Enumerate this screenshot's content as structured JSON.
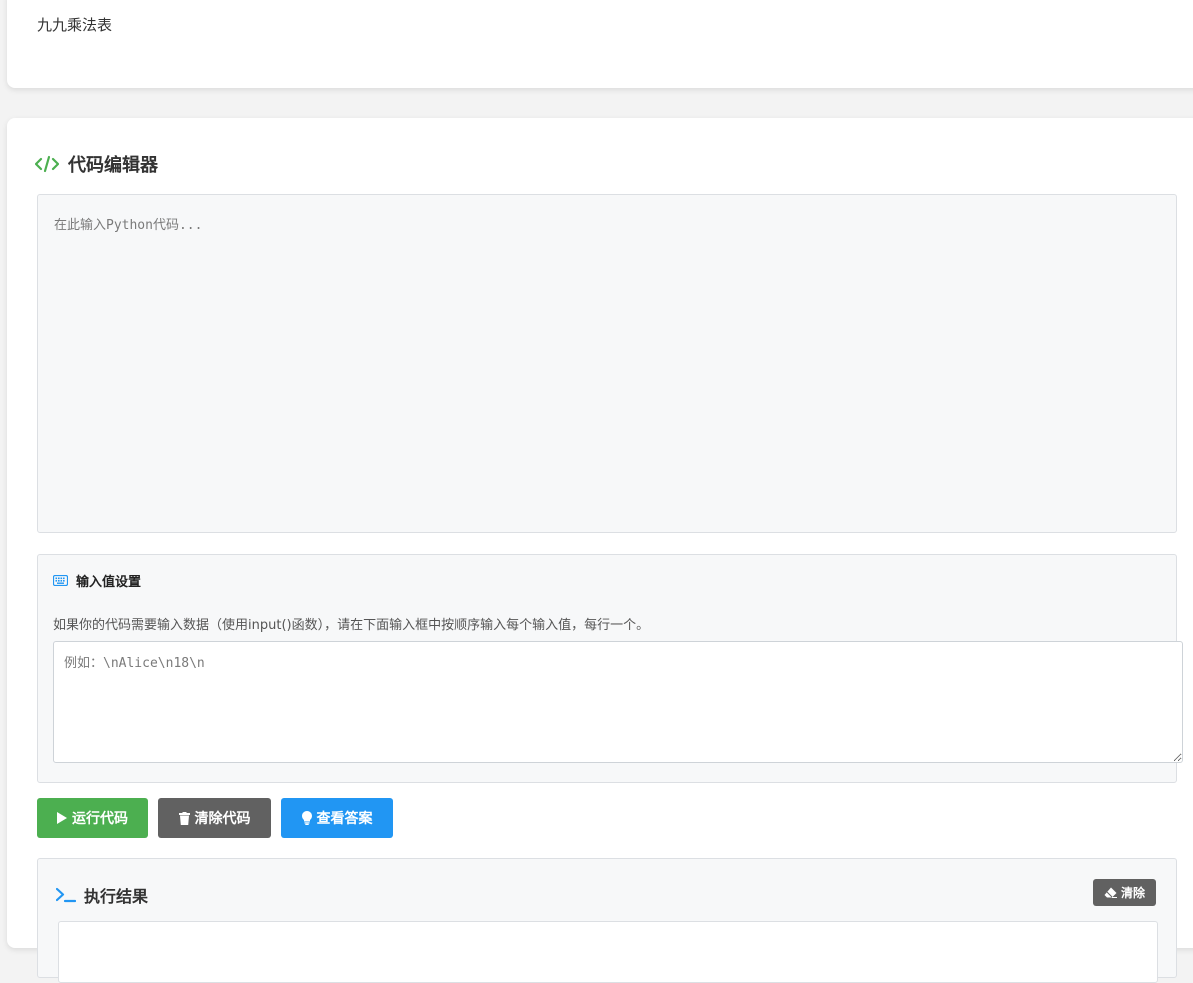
{
  "problem": {
    "title": "九九乘法表"
  },
  "editor": {
    "title": "代码编辑器",
    "code_value": "",
    "code_placeholder": "在此输入Python代码..."
  },
  "input_settings": {
    "title": "输入值设置",
    "description": "如果你的代码需要输入数据（使用input()函数），请在下面输入框中按顺序输入每个输入值，每行一个。",
    "value": "",
    "placeholder": "例如：\\nAlice\\n18\\n"
  },
  "buttons": {
    "run_label": "运行代码",
    "clear_code_label": "清除代码",
    "view_answer_label": "查看答案"
  },
  "result": {
    "title": "执行结果",
    "clear_label": "清除",
    "output": ""
  },
  "icons": {
    "editor": "code-icon",
    "input_settings": "keyboard-icon",
    "run": "play-icon",
    "clear_code": "trash-icon",
    "view_answer": "lightbulb-icon",
    "result": "terminal-icon",
    "result_clear": "eraser-icon"
  },
  "colors": {
    "run_button": "#4caf50",
    "clear_button": "#616161",
    "answer_button": "#2196f3",
    "editor_icon": "#4caf50",
    "info_icon": "#2196f3"
  }
}
